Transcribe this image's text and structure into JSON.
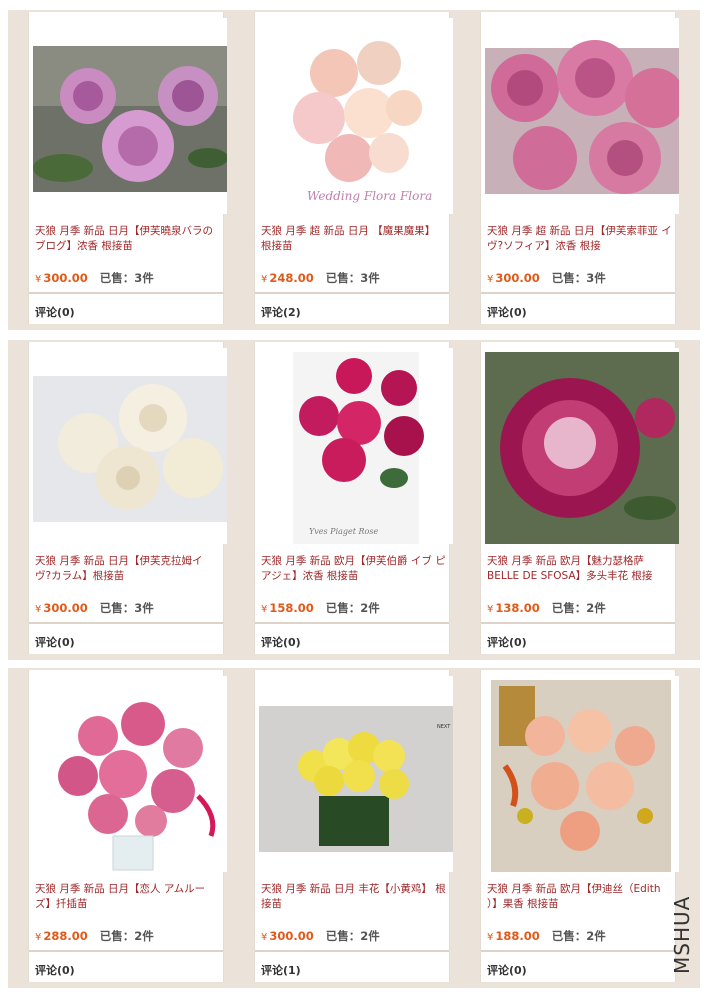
{
  "products": [
    {
      "title": "天狼 月季 新品 日月【伊芙曉泉バラの ブログ】浓香 根接苗",
      "price": "300.00",
      "sold": "已售：3件",
      "reviews": "评论(0)",
      "img_alt": "pink-roses",
      "img_label": ""
    },
    {
      "title": "天狼 月季 超 新品 日月 【魔果魔果】 根接苗",
      "price": "248.00",
      "sold": "已售：3件",
      "reviews": "评论(2)",
      "img_alt": "wedding-bouquet",
      "img_label": "Wedding Flora Flora"
    },
    {
      "title": "天狼 月季 超 新品 日月【伊芙索菲亚 イヴ?ソフィア】浓香 根接",
      "price": "300.00",
      "sold": "已售：3件",
      "reviews": "评论(0)",
      "img_alt": "pink-roses-cluster",
      "img_label": ""
    },
    {
      "title": "天狼 月季 新品 日月【伊芙克拉姆イ ヴ?カラム】根接苗",
      "price": "300.00",
      "sold": "已售：3件",
      "reviews": "评论(0)",
      "img_alt": "white-roses",
      "img_label": ""
    },
    {
      "title": "天狼 月季 新品 欧月【伊芙伯爵 イブ ピアジェ】浓香 根接苗",
      "price": "158.00",
      "sold": "已售：2件",
      "reviews": "评论(0)",
      "img_alt": "magenta-roses-vase",
      "img_label": "Yves Piaget Rose"
    },
    {
      "title": "天狼 月季 新品 欧月【魅力瑟格萨 BELLE DE SFOSA】多头丰花 根接",
      "price": "138.00",
      "sold": "已售：2件",
      "reviews": "评论(0)",
      "img_alt": "crimson-rose",
      "img_label": ""
    },
    {
      "title": "天狼 月季 新品 日月【恋人 アムルー ズ】扦插苗",
      "price": "288.00",
      "sold": "已售：2件",
      "reviews": "评论(0)",
      "img_alt": "pink-bouquet",
      "img_label": ""
    },
    {
      "title": "天狼 月季 新品 日月 丰花【小黄鸡】 根接苗",
      "price": "300.00",
      "sold": "已售：2件",
      "reviews": "评论(1)",
      "img_alt": "yellow-roses",
      "img_label": "NEXT"
    },
    {
      "title": "天狼 月季 新品 欧月【伊迪丝（Edith ）】果香 根接苗",
      "price": "188.00",
      "sold": "已售：2件",
      "reviews": "评论(0)",
      "img_alt": "peach-bouquet",
      "img_label": ""
    }
  ],
  "currency_symbol": "¥",
  "watermark": "MSHUA",
  "colors": {
    "title": "#a0282a",
    "price": "#e05a1a",
    "band": "#ebe3d9"
  }
}
